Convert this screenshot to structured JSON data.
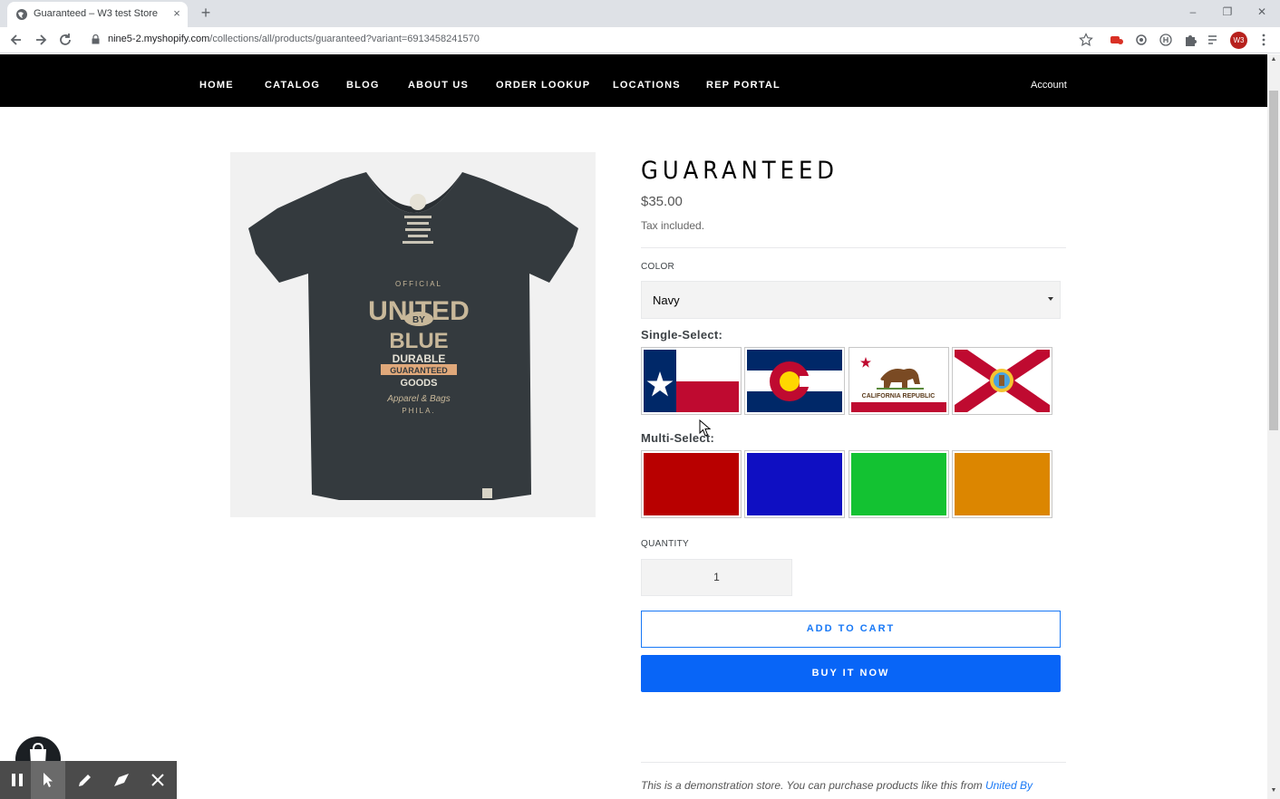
{
  "browser": {
    "tab_title": "Guaranteed – W3 test Store",
    "tab_close": "×",
    "new_tab": "+",
    "url_host": "nine5-2.myshopify.com",
    "url_path": "/collections/all/products/guaranteed?variant=6913458241570",
    "profile_initials": "W3",
    "window_controls": {
      "minimize": "–",
      "restore": "❐",
      "close": "✕"
    }
  },
  "nav": {
    "items": [
      {
        "label": "HOME"
      },
      {
        "label": "CATALOG"
      },
      {
        "label": "BLOG"
      },
      {
        "label": "ABOUT US"
      },
      {
        "label": "ORDER LOOKUP"
      },
      {
        "label": "LOCATIONS"
      },
      {
        "label": "REP PORTAL"
      }
    ],
    "account": "Account"
  },
  "product": {
    "title": "GUARANTEED",
    "price": "$35.00",
    "tax_note": "Tax included.",
    "color_label": "COLOR",
    "color_value": "Navy",
    "single_select_label": "Single-Select:",
    "single_select_options": [
      "texas-flag",
      "colorado-flag",
      "california-flag",
      "florida-flag"
    ],
    "california_flag_text": "CALIFORNIA REPUBLIC",
    "multi_select_label": "Multi-Select:",
    "multi_select_colors": [
      "#b80000",
      "#0f0fc2",
      "#13c232",
      "#dc8600"
    ],
    "quantity_label": "QUANTITY",
    "quantity_value": "1",
    "add_to_cart": "ADD TO CART",
    "buy_now": "BUY IT NOW",
    "description_prefix": "This is a demonstration store. You can purchase products like this from ",
    "description_link": "United By"
  },
  "colors": {
    "nav_bg": "#000000",
    "accent": "#1878f6",
    "buy_button": "#0865f7"
  }
}
